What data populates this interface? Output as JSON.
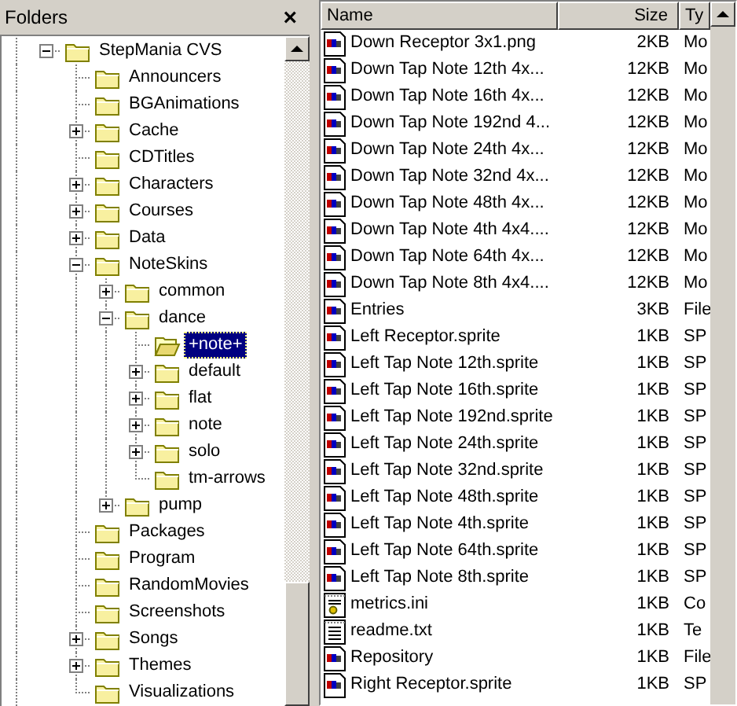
{
  "folders_pane": {
    "title": "Folders",
    "close_button": "×",
    "tree": [
      {
        "label": "StepMania CVS",
        "selected": false,
        "expanded": true,
        "children": [
          {
            "label": "Announcers",
            "selected": false
          },
          {
            "label": "BGAnimations",
            "selected": false
          },
          {
            "label": "Cache",
            "selected": false,
            "expanded": false
          },
          {
            "label": "CDTitles",
            "selected": false
          },
          {
            "label": "Characters",
            "selected": false,
            "expanded": false
          },
          {
            "label": "Courses",
            "selected": false,
            "expanded": false
          },
          {
            "label": "Data",
            "selected": false,
            "expanded": false
          },
          {
            "label": "NoteSkins",
            "selected": false,
            "expanded": true,
            "children": [
              {
                "label": "common",
                "selected": false,
                "expanded": false
              },
              {
                "label": "dance",
                "selected": false,
                "expanded": true,
                "children": [
                  {
                    "label": "+note+",
                    "selected": true
                  },
                  {
                    "label": "default",
                    "selected": false,
                    "expanded": false
                  },
                  {
                    "label": "flat",
                    "selected": false,
                    "expanded": false
                  },
                  {
                    "label": "note",
                    "selected": false,
                    "expanded": false
                  },
                  {
                    "label": "solo",
                    "selected": false,
                    "expanded": false
                  },
                  {
                    "label": "tm-arrows",
                    "selected": false
                  }
                ]
              },
              {
                "label": "pump",
                "selected": false,
                "expanded": false
              }
            ]
          },
          {
            "label": "Packages",
            "selected": false
          },
          {
            "label": "Program",
            "selected": false
          },
          {
            "label": "RandomMovies",
            "selected": false
          },
          {
            "label": "Screenshots",
            "selected": false
          },
          {
            "label": "Songs",
            "selected": false,
            "expanded": false
          },
          {
            "label": "Themes",
            "selected": false,
            "expanded": false
          },
          {
            "label": "Visualizations",
            "selected": false
          }
        ]
      }
    ]
  },
  "file_list": {
    "columns": [
      "Name",
      "Size",
      "Ty"
    ],
    "rows": [
      {
        "name": "Down Receptor 3x1.png",
        "size": "2KB",
        "type": "Mo",
        "kind": "image"
      },
      {
        "name": "Down Tap Note 12th 4x...",
        "size": "12KB",
        "type": "Mo",
        "kind": "image"
      },
      {
        "name": "Down Tap Note 16th 4x...",
        "size": "12KB",
        "type": "Mo",
        "kind": "image"
      },
      {
        "name": "Down Tap Note 192nd 4...",
        "size": "12KB",
        "type": "Mo",
        "kind": "image"
      },
      {
        "name": "Down Tap Note 24th 4x...",
        "size": "12KB",
        "type": "Mo",
        "kind": "image"
      },
      {
        "name": "Down Tap Note 32nd 4x...",
        "size": "12KB",
        "type": "Mo",
        "kind": "image"
      },
      {
        "name": "Down Tap Note 48th 4x...",
        "size": "12KB",
        "type": "Mo",
        "kind": "image"
      },
      {
        "name": "Down Tap Note 4th 4x4....",
        "size": "12KB",
        "type": "Mo",
        "kind": "image"
      },
      {
        "name": "Down Tap Note 64th 4x...",
        "size": "12KB",
        "type": "Mo",
        "kind": "image"
      },
      {
        "name": "Down Tap Note 8th 4x4....",
        "size": "12KB",
        "type": "Mo",
        "kind": "image"
      },
      {
        "name": "Entries",
        "size": "3KB",
        "type": "File",
        "kind": "image"
      },
      {
        "name": "Left Receptor.sprite",
        "size": "1KB",
        "type": "SP",
        "kind": "image"
      },
      {
        "name": "Left Tap Note 12th.sprite",
        "size": "1KB",
        "type": "SP",
        "kind": "image"
      },
      {
        "name": "Left Tap Note 16th.sprite",
        "size": "1KB",
        "type": "SP",
        "kind": "image"
      },
      {
        "name": "Left Tap Note 192nd.sprite",
        "size": "1KB",
        "type": "SP",
        "kind": "image"
      },
      {
        "name": "Left Tap Note 24th.sprite",
        "size": "1KB",
        "type": "SP",
        "kind": "image"
      },
      {
        "name": "Left Tap Note 32nd.sprite",
        "size": "1KB",
        "type": "SP",
        "kind": "image"
      },
      {
        "name": "Left Tap Note 48th.sprite",
        "size": "1KB",
        "type": "SP",
        "kind": "image"
      },
      {
        "name": "Left Tap Note 4th.sprite",
        "size": "1KB",
        "type": "SP",
        "kind": "image"
      },
      {
        "name": "Left Tap Note 64th.sprite",
        "size": "1KB",
        "type": "SP",
        "kind": "image"
      },
      {
        "name": "Left Tap Note 8th.sprite",
        "size": "1KB",
        "type": "SP",
        "kind": "image"
      },
      {
        "name": "metrics.ini",
        "size": "1KB",
        "type": "Co",
        "kind": "settings"
      },
      {
        "name": "readme.txt",
        "size": "1KB",
        "type": "Te",
        "kind": "text"
      },
      {
        "name": "Repository",
        "size": "1KB",
        "type": "File",
        "kind": "image"
      },
      {
        "name": "Right Receptor.sprite",
        "size": "1KB",
        "type": "SP",
        "kind": "image"
      }
    ]
  }
}
